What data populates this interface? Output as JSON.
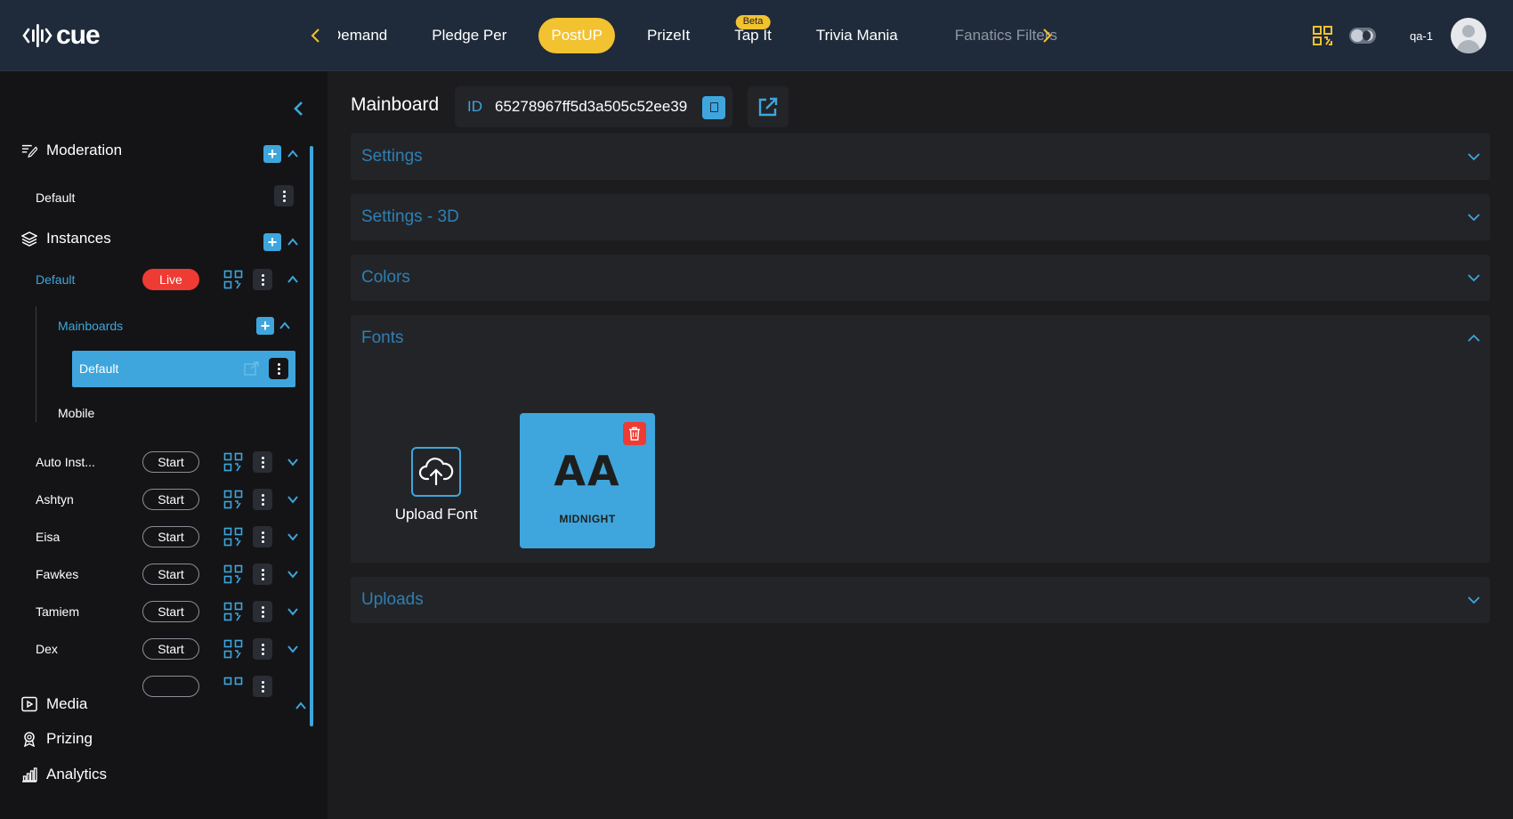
{
  "header": {
    "logo_text": "cue",
    "tabs": [
      {
        "label": "Demand",
        "state": "partial"
      },
      {
        "label": "Pledge Per",
        "state": "normal"
      },
      {
        "label": "PostUP",
        "state": "active"
      },
      {
        "label": "PrizeIt",
        "state": "normal"
      },
      {
        "label": "Tap It",
        "state": "normal",
        "badge": "Beta"
      },
      {
        "label": "Trivia Mania",
        "state": "normal"
      },
      {
        "label": "Fanatics Filters",
        "state": "muted"
      }
    ],
    "user_name": "qa-1",
    "accent_color": "#f2c230"
  },
  "sidebar": {
    "moderation": {
      "label": "Moderation",
      "items": [
        {
          "label": "Default"
        }
      ]
    },
    "instances": {
      "label": "Instances",
      "default_instance": {
        "label": "Default",
        "status": "Live"
      },
      "mainboards": {
        "label": "Mainboards",
        "items": [
          {
            "label": "Default"
          },
          {
            "label": "Mobile"
          }
        ]
      },
      "others": [
        {
          "label": "Auto Inst...",
          "action": "Start"
        },
        {
          "label": "Ashtyn",
          "action": "Start"
        },
        {
          "label": "Eisa",
          "action": "Start"
        },
        {
          "label": "Fawkes",
          "action": "Start"
        },
        {
          "label": "Tamiem",
          "action": "Start"
        },
        {
          "label": "Dex",
          "action": "Start"
        }
      ]
    },
    "media_label": "Media",
    "prizing_label": "Prizing",
    "analytics_label": "Analytics",
    "accent_color": "#3ea6dd",
    "live_color": "#ee3b33"
  },
  "main": {
    "title": "Mainboard",
    "id_label": "ID",
    "id_value": "65278967ff5d3a505c52ee39",
    "panels": [
      {
        "label": "Settings",
        "expanded": false
      },
      {
        "label": "Settings - 3D",
        "expanded": false
      },
      {
        "label": "Colors",
        "expanded": false
      },
      {
        "label": "Fonts",
        "expanded": true
      },
      {
        "label": "Uploads",
        "expanded": false
      }
    ],
    "fonts": {
      "upload_label": "Upload Font",
      "items": [
        {
          "preview": "AA",
          "name": "MIDNIGHT"
        }
      ]
    }
  }
}
